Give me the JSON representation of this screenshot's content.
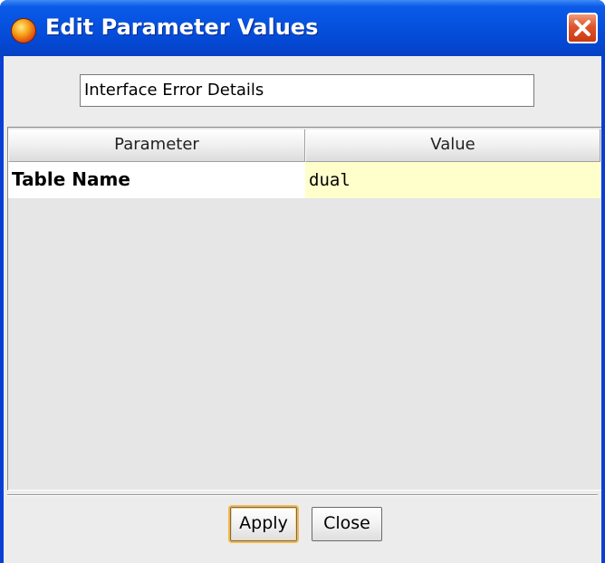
{
  "window": {
    "title": "Edit Parameter Values"
  },
  "description_field": {
    "value": "Interface Error Details"
  },
  "table": {
    "columns": [
      "Parameter",
      "Value"
    ],
    "rows": [
      {
        "parameter": "Table Name",
        "value": "dual"
      }
    ]
  },
  "buttons": {
    "apply_label": "Apply",
    "close_label": "Close"
  },
  "icons": {
    "app": "app-orb-icon",
    "close": "close-x-icon"
  },
  "colors": {
    "titlebar": "#0653e0",
    "close_button": "#e0542a",
    "value_cell_bg": "#ffffcc",
    "apply_focus": "#f5b94a"
  }
}
